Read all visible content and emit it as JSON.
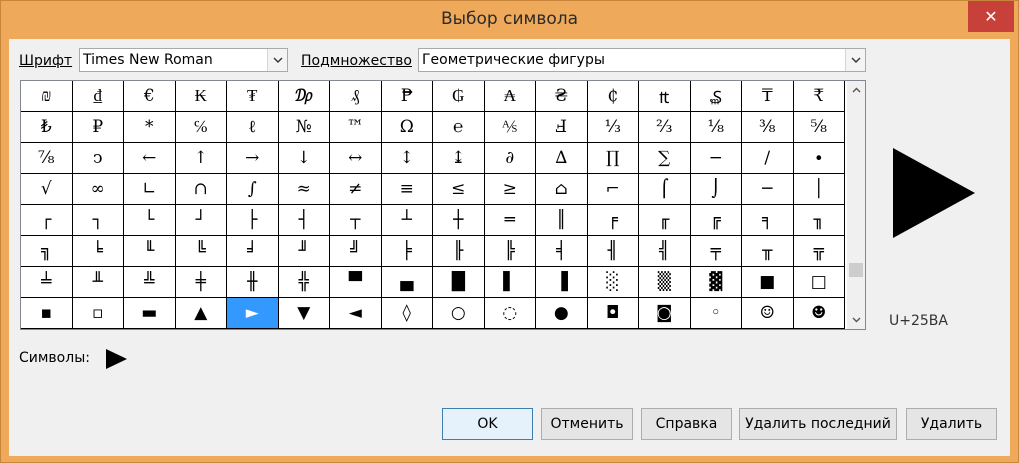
{
  "window": {
    "title": "Выбор символа",
    "close_glyph": "✕"
  },
  "font": {
    "label": "Шрифт",
    "value": "Times New Roman"
  },
  "subset": {
    "label": "Подмножество",
    "value": "Геометрические фигуры"
  },
  "grid": {
    "selected": "►",
    "rows": [
      [
        "₪",
        "₫",
        "€",
        "₭",
        "₮",
        "₯",
        "₰",
        "₱",
        "₲",
        "₳",
        "₴",
        "₵",
        "₶",
        "₷",
        "₸",
        "₹"
      ],
      [
        "₺",
        "₽",
        "*",
        "℅",
        "ℓ",
        "№",
        "™",
        "Ω",
        "℮",
        "⅍",
        "Ⅎ",
        "⅓",
        "⅔",
        "⅛",
        "⅜",
        "⅝"
      ],
      [
        "⅞",
        "ↄ",
        "←",
        "↑",
        "→",
        "↓",
        "↔",
        "↕",
        "↨",
        "∂",
        "∆",
        "∏",
        "∑",
        "−",
        "∕",
        "∙"
      ],
      [
        "√",
        "∞",
        "∟",
        "∩",
        "∫",
        "≈",
        "≠",
        "≡",
        "≤",
        "≥",
        "⌂",
        "⌐",
        "⌠",
        "⌡",
        "─",
        "│"
      ],
      [
        "┌",
        "┐",
        "└",
        "┘",
        "├",
        "┤",
        "┬",
        "┴",
        "┼",
        "═",
        "║",
        "╒",
        "╓",
        "╔",
        "╕",
        "╖"
      ],
      [
        "╗",
        "╘",
        "╙",
        "╚",
        "╛",
        "╜",
        "╝",
        "╞",
        "╟",
        "╠",
        "╡",
        "╢",
        "╣",
        "╤",
        "╥",
        "╦"
      ],
      [
        "╧",
        "╨",
        "╩",
        "╪",
        "╫",
        "╬",
        "▀",
        "▄",
        "█",
        "▌",
        "▐",
        "░",
        "▒",
        "▓",
        "■",
        "□"
      ],
      [
        "▪",
        "▫",
        "▬",
        "▲",
        "►",
        "▼",
        "◄",
        "◊",
        "○",
        "◌",
        "●",
        "◘",
        "◙",
        "◦",
        "☺",
        "☻"
      ]
    ]
  },
  "preview": {
    "glyph": "►",
    "code": "U+25BA"
  },
  "symbols": {
    "label": "Символы:",
    "value": "►"
  },
  "buttons": {
    "ok": "OK",
    "cancel": "Отменить",
    "help": "Справка",
    "delete_last": "Удалить последний",
    "delete": "Удалить"
  },
  "colors": {
    "frame": "#efa95a",
    "close": "#c7403a",
    "selection": "#3399ff"
  }
}
